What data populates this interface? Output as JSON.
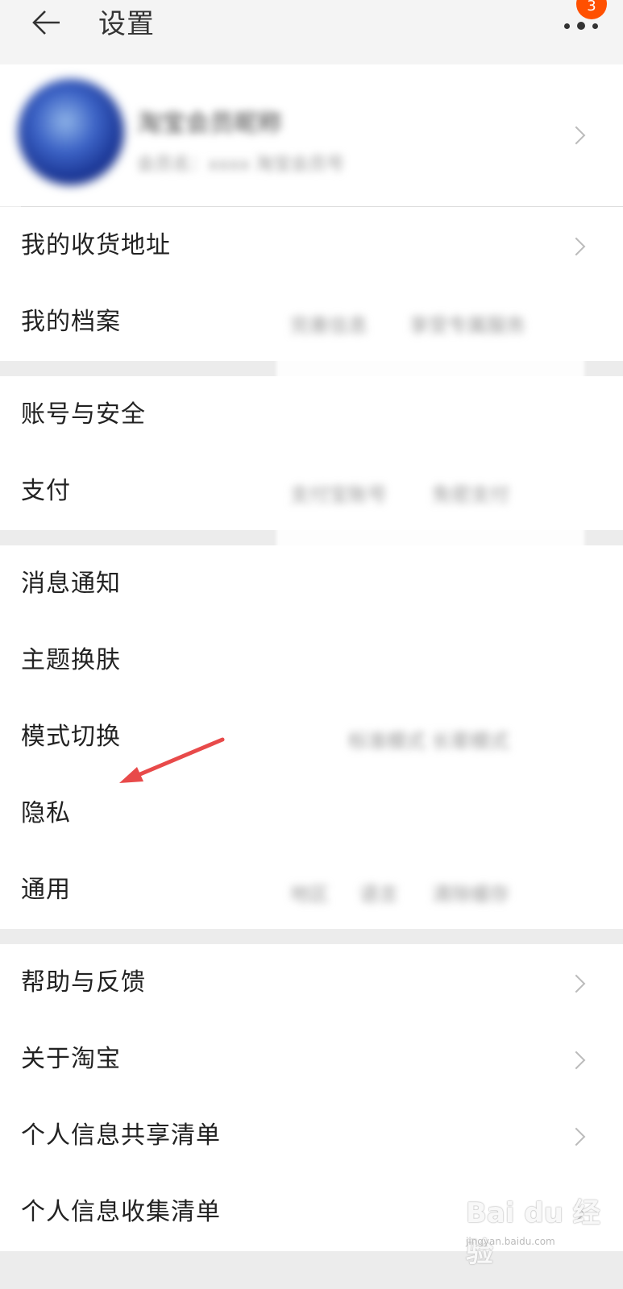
{
  "header": {
    "title": "设置",
    "back_icon": "back-arrow-icon",
    "more_icon": "more-dots-icon",
    "badge_count": "3"
  },
  "profile": {
    "name": "淘宝会员昵称",
    "subtitle": "会员名：xxxx 淘宝会员号"
  },
  "groups": [
    {
      "items": [
        {
          "label": "我的收货地址"
        },
        {
          "label": "我的档案",
          "values": [
            "完善信息",
            "享受专属服务"
          ]
        }
      ]
    },
    {
      "items": [
        {
          "label": "账号与安全"
        },
        {
          "label": "支付",
          "values": [
            "支付宝账号",
            "免密支付"
          ]
        }
      ]
    },
    {
      "items": [
        {
          "label": "消息通知"
        },
        {
          "label": "主题换肤"
        },
        {
          "label": "模式切换",
          "values": [
            "标准模式 长辈模式"
          ]
        },
        {
          "label": "隐私"
        },
        {
          "label": "通用",
          "values": [
            "地区",
            "语言",
            "清除缓存"
          ]
        }
      ]
    },
    {
      "items": [
        {
          "label": "帮助与反馈"
        },
        {
          "label": "关于淘宝"
        },
        {
          "label": "个人信息共享清单"
        },
        {
          "label": "个人信息收集清单"
        }
      ]
    }
  ],
  "annotation": {
    "arrow_color": "#e84a4a"
  },
  "watermark": {
    "text": "Bai du 经验",
    "sub": "jingyan.baidu.com"
  },
  "colors": {
    "accent": "#ff5000",
    "background": "#ececec",
    "row_bg": "#ffffff",
    "text": "#222222",
    "separator": "#dcdcdc"
  }
}
